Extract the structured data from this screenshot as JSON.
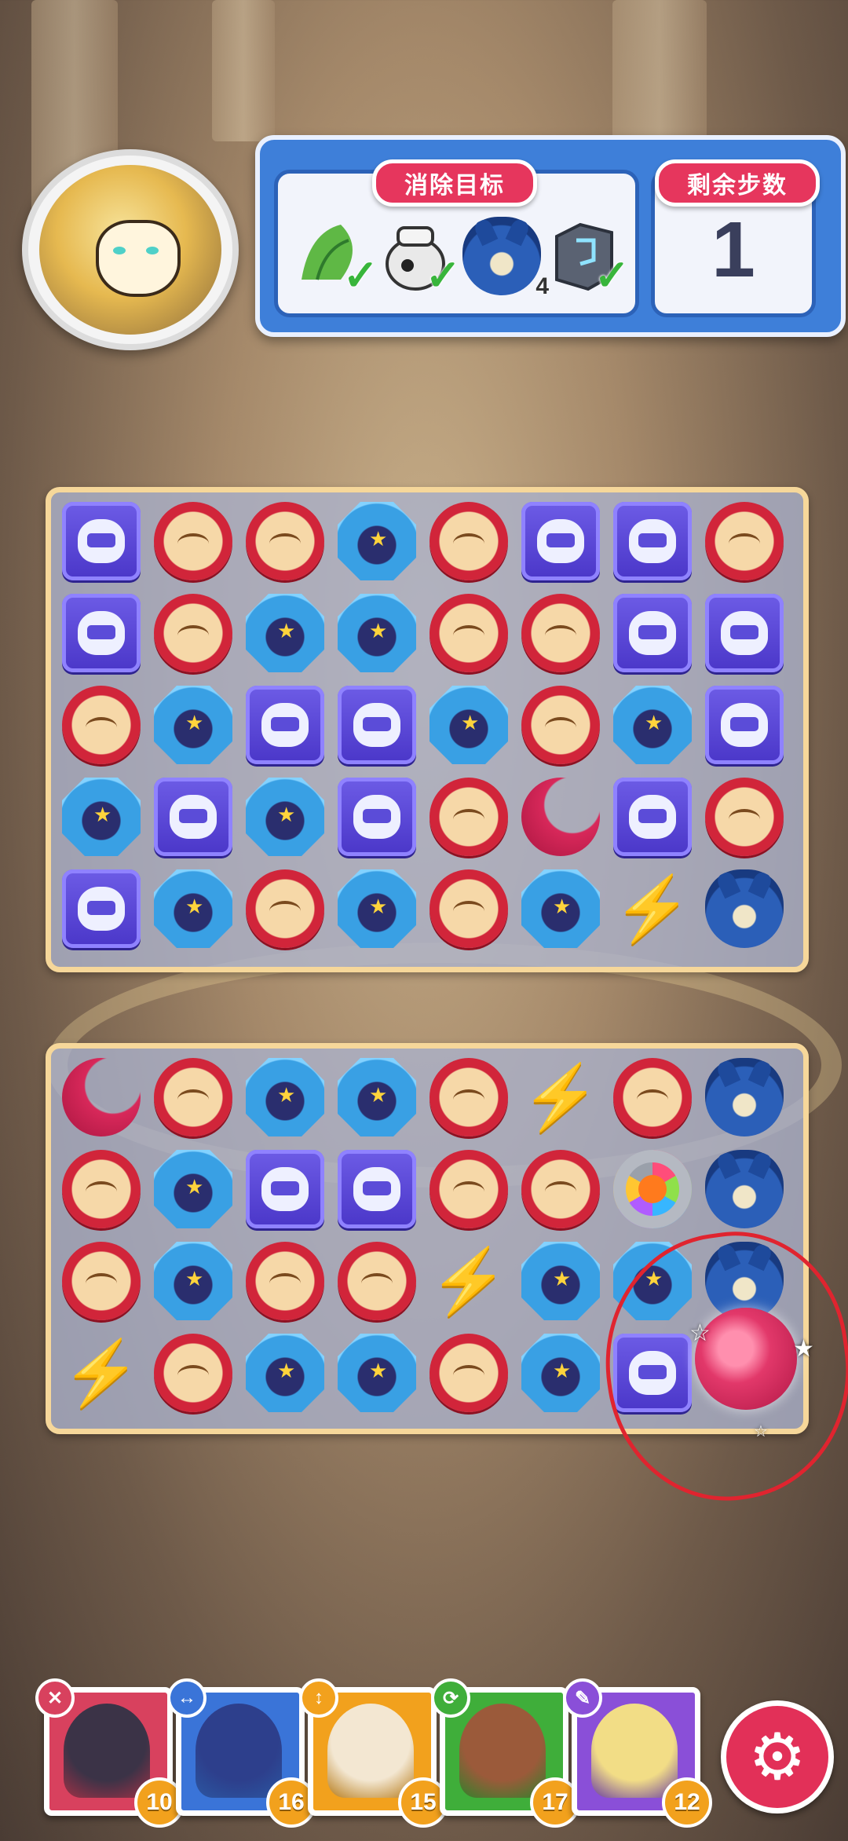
{
  "goals": {
    "title": "消除目标",
    "items": [
      {
        "name": "leaf-goal",
        "icon": "leaf-icon",
        "status": "done"
      },
      {
        "name": "pot-goal",
        "icon": "pot-icon",
        "status": "done"
      },
      {
        "name": "spider-goal",
        "icon": "spider-icon",
        "count": "4"
      },
      {
        "name": "stone-goal",
        "icon": "stone-block-icon",
        "status": "done"
      }
    ]
  },
  "steps": {
    "title": "剩余步数",
    "value": "1"
  },
  "board_top": [
    [
      "purple",
      "red",
      "red",
      "blue",
      "red",
      "purple",
      "purple",
      "red"
    ],
    [
      "purple",
      "red",
      "blue",
      "blue",
      "red",
      "red",
      "purple",
      "purple"
    ],
    [
      "red",
      "blue",
      "purple",
      "purple",
      "blue",
      "red",
      "blue",
      "purple"
    ],
    [
      "blue",
      "purple",
      "blue",
      "purple",
      "red",
      "moon",
      "purple",
      "red"
    ],
    [
      "purple",
      "blue",
      "red",
      "blue",
      "red",
      "blue",
      "bolt",
      "spider"
    ]
  ],
  "board_bottom": [
    [
      "moon",
      "red",
      "blue",
      "blue",
      "red",
      "bolt",
      "red",
      "spider"
    ],
    [
      "red",
      "blue",
      "purple",
      "purple",
      "red",
      "red",
      "disco",
      "spider"
    ],
    [
      "red",
      "blue",
      "red",
      "red",
      "bolt",
      "blue",
      "blue",
      "spider"
    ],
    [
      "bolt",
      "red",
      "blue",
      "blue",
      "red",
      "blue",
      "purple",
      "empty"
    ]
  ],
  "heroes": [
    {
      "level": "10",
      "skill": "✕",
      "color": "#d8415e"
    },
    {
      "level": "16",
      "skill": "↔",
      "color": "#3a74d8"
    },
    {
      "level": "15",
      "skill": "↕",
      "color": "#f2a11d"
    },
    {
      "level": "17",
      "skill": "⟳",
      "color": "#3fae3a"
    },
    {
      "level": "12",
      "skill": "✎",
      "color": "#8a4fd8"
    }
  ],
  "settings": {
    "icon": "gear-icon"
  }
}
